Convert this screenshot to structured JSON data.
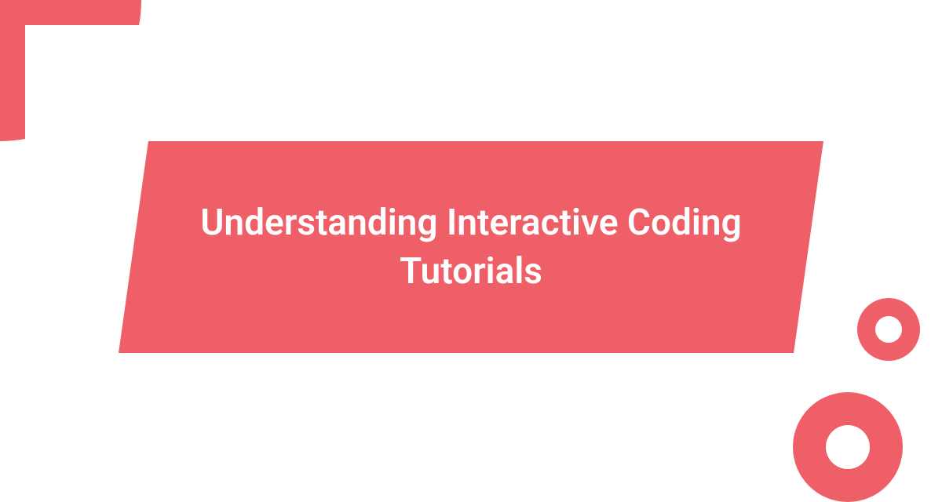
{
  "title": "Understanding Interactive Coding Tutorials",
  "colors": {
    "accent": "#ef5f67",
    "background": "#ffffff",
    "text": "#ffffff"
  }
}
